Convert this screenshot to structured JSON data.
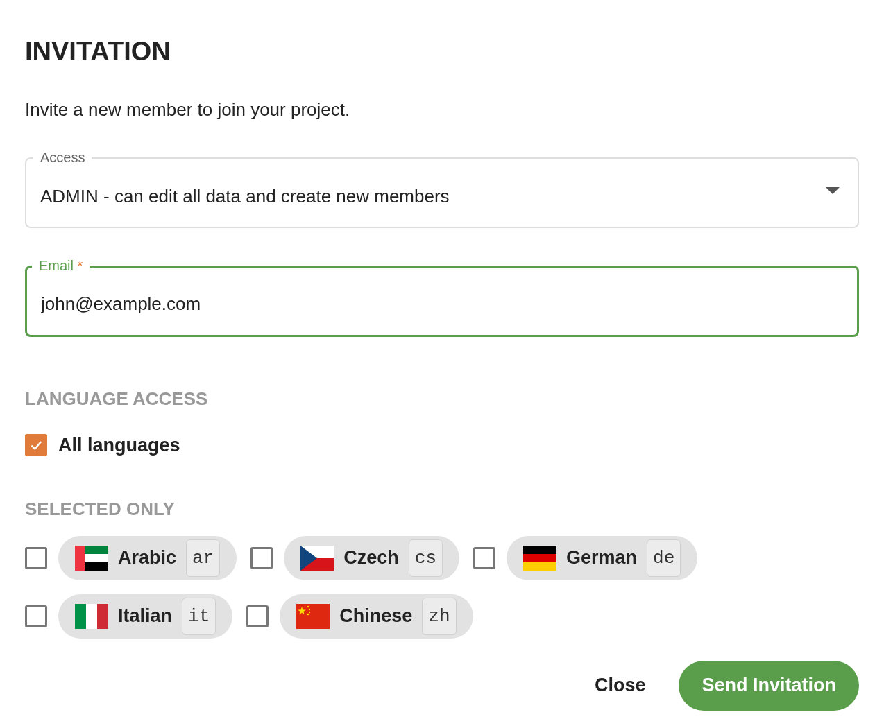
{
  "title": "INVITATION",
  "subtitle": "Invite a new member to join your project.",
  "access": {
    "label": "Access",
    "value": "ADMIN - can edit all data and create new members"
  },
  "email": {
    "label": "Email",
    "required_mark": "*",
    "value": "john@example.com",
    "focused": true
  },
  "language_access": {
    "heading": "LANGUAGE ACCESS",
    "all": {
      "label": "All languages",
      "checked": true
    }
  },
  "selected_only": {
    "heading": "SELECTED ONLY",
    "languages": [
      {
        "name": "Arabic",
        "code": "ar",
        "checked": false
      },
      {
        "name": "Czech",
        "code": "cs",
        "checked": false
      },
      {
        "name": "German",
        "code": "de",
        "checked": false
      },
      {
        "name": "Italian",
        "code": "it",
        "checked": false
      },
      {
        "name": "Chinese",
        "code": "zh",
        "checked": false
      }
    ]
  },
  "buttons": {
    "close": "Close",
    "send": "Send Invitation"
  }
}
